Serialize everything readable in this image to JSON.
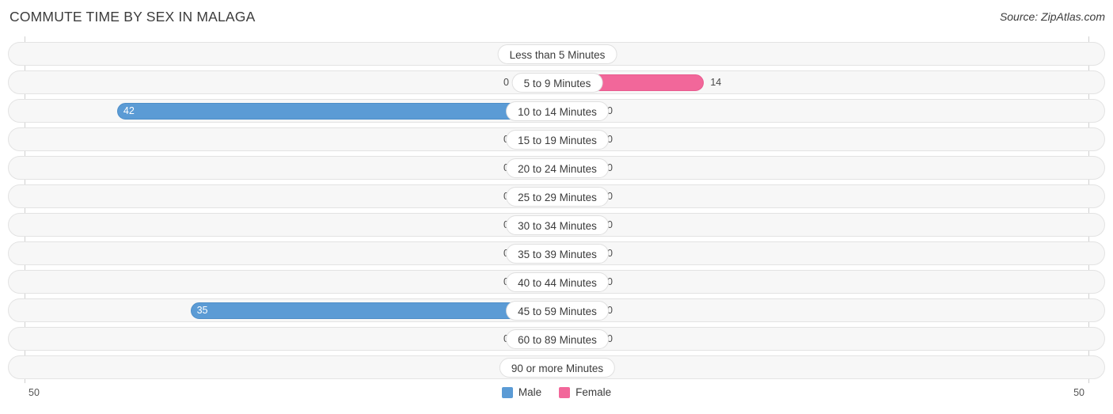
{
  "header": {
    "title": "COMMUTE TIME BY SEX IN MALAGA",
    "source": "Source: ZipAtlas.com"
  },
  "legend": {
    "male_label": "Male",
    "female_label": "Female",
    "male_color": "#5b9bd5",
    "female_color": "#f2679a"
  },
  "axis": {
    "left_max_label": "50",
    "right_max_label": "50"
  },
  "chart_data": {
    "type": "bar",
    "title": "COMMUTE TIME BY SEX IN MALAGA",
    "orientation": "horizontal-diverging",
    "xlabel": "",
    "ylabel": "",
    "xlim": [
      50,
      50
    ],
    "grid": false,
    "legend_position": "bottom-center",
    "categories": [
      "Less than 5 Minutes",
      "5 to 9 Minutes",
      "10 to 14 Minutes",
      "15 to 19 Minutes",
      "20 to 24 Minutes",
      "25 to 29 Minutes",
      "30 to 34 Minutes",
      "35 to 39 Minutes",
      "40 to 44 Minutes",
      "45 to 59 Minutes",
      "60 to 89 Minutes",
      "90 or more Minutes"
    ],
    "series": [
      {
        "name": "Male",
        "color": "#5b9bd5",
        "values": [
          0,
          0,
          42,
          0,
          0,
          0,
          0,
          0,
          0,
          35,
          0,
          0
        ]
      },
      {
        "name": "Female",
        "color": "#f2679a",
        "values": [
          0,
          14,
          0,
          0,
          0,
          0,
          0,
          0,
          0,
          0,
          0,
          0
        ]
      }
    ],
    "value_labels": {
      "male": [
        "0",
        "0",
        "42",
        "0",
        "0",
        "0",
        "0",
        "0",
        "0",
        "35",
        "0",
        "0"
      ],
      "female": [
        "0",
        "14",
        "0",
        "0",
        "0",
        "0",
        "0",
        "0",
        "0",
        "0",
        "0",
        "0"
      ]
    }
  }
}
